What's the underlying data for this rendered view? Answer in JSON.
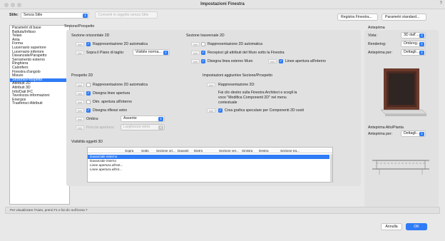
{
  "window": {
    "title": "Impostazioni Finestra",
    "help": "?"
  },
  "top": {
    "style_label": "Stile:",
    "style_value": "Senza Stile",
    "convert_button": "Converti in oggetto senza Stile",
    "register_button": "Registra Finestra...",
    "standard_button": "Parametri standard..."
  },
  "sidebar": {
    "items": [
      "Parametri di base",
      "Battuta/Infisso",
      "Telaio",
      "Anta",
      "Forma",
      "Lucernario superiore",
      "Lucernario inferiore",
      "Davanzale/Parapetto",
      "Serramento esterno",
      "Ringhiera",
      "Calorifero",
      "Finestra d'angolo",
      "Misure",
      "Sezione/Prospetto",
      "Attributi 2D",
      "Attributi 3D",
      "Info/Dati IFC",
      "Tavolozza informazioni",
      "Energos",
      "Trasferisci Attributi"
    ],
    "selected_index": 13
  },
  "main": {
    "section_title": "Sezione/Prospetto",
    "horizontal": {
      "title": "Sezione orizzontale 2D",
      "auto2d": "Rappresentazione 2D automatica",
      "auto2d_checked": true,
      "above_cut": "Sopra il Piano di taglio:",
      "above_cut_value": "Visibile norma..."
    },
    "transverse": {
      "title": "Sezione trasversale 2D",
      "auto2d": "Rappresentazione 2D automatica",
      "auto2d_checked": false,
      "wall_attr": "Recepisci gli attributi del Muro sotto la Finestra",
      "wall_attr_checked": true,
      "outer_line": "Disegna linea esterno Muro",
      "outer_line_checked": true,
      "inner_line": "Linee apertura all'interno",
      "inner_line_checked": true
    },
    "elevation": {
      "title": "Prospetto 2D",
      "auto2d": "Rappresentazione 2D automatica",
      "auto2d_checked": false,
      "opening_lines": "Disegna linee apertura",
      "opening_lines_checked": true,
      "opening_inside": "Dim. apertura all'interno",
      "opening_inside_checked": false,
      "glass_reflect": "Disegna riflessi vetro",
      "glass_reflect_checked": true,
      "shadow_label": "Ombra:",
      "shadow_value": "Assente",
      "arrow_label": "Freccia apertura:",
      "arrow_value": "Larghezza vetro"
    },
    "additional": {
      "title": "Impostazioni aggiuntive Sezione/Prospetto",
      "rep2d": "Rappresentazione 2D:",
      "help_text": [
        "Fai clic-destro sulla Finestra Architect e scegli la",
        "voce \"Modifica Componenti 2D\" nel menu",
        "contestuale"
      ],
      "mirror": "Crea grafica speculare per Componenti 2D vuoti",
      "mirror_checked": true
    },
    "visibility": {
      "title": "Visibilità oggetti 3D",
      "columns": [
        "Sopra",
        "Sotto",
        "Sezione ori...",
        "Davanti",
        "Dietro",
        "Sezione ver...",
        "Sinistra",
        "Destra",
        "Sezione tra..."
      ],
      "rows": [
        "Davanzale esterno",
        "Davanzale interno",
        "Linee apertura all'est...",
        "Linee apertura all'int..."
      ],
      "selected_row": 0
    }
  },
  "preview": {
    "title": "Anteprima",
    "view_label": "Vista:",
    "view_value": "3D dall'...",
    "render_label": "Rendering:",
    "render_value": "Ombreg...",
    "preview_for_label": "Anteprima per:",
    "preview_for_value": "Dettagli...",
    "plan_title": "Anteprima Alto/Pianta",
    "plan_for_label": "Anteprima per:",
    "plan_for_value": "Dettagli..."
  },
  "status": {
    "text": "Per visualizzare l'Aiuto, premi F1 e fai clic sull'icona ?"
  },
  "footer": {
    "cancel": "Annulla",
    "ok": "OK"
  },
  "colors": {
    "accent": "#2f7cf6",
    "frame": "#6b3a2c"
  }
}
